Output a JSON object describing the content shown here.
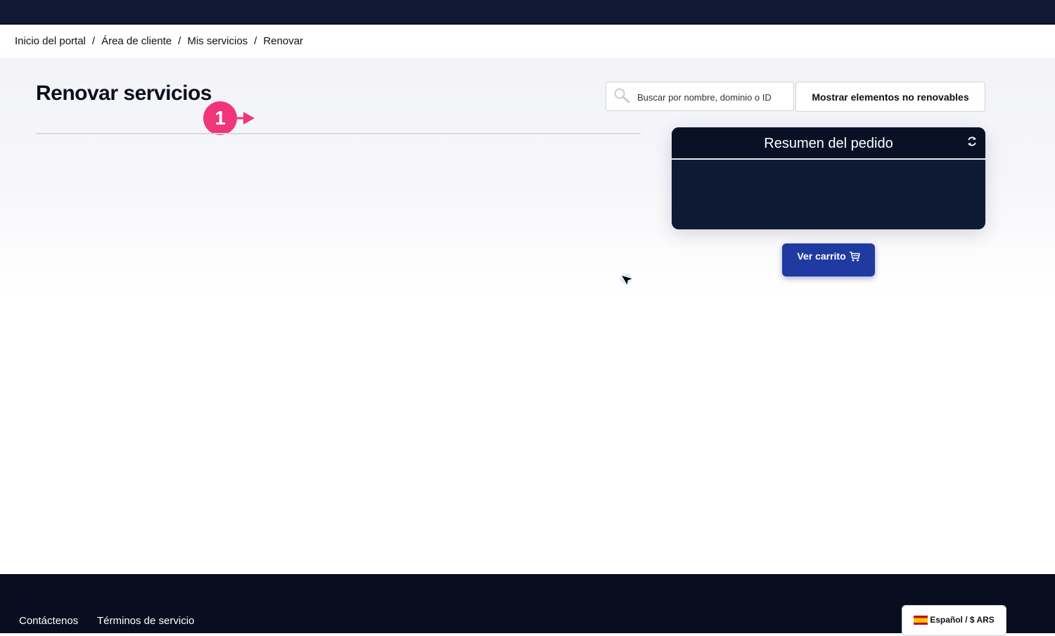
{
  "breadcrumb": {
    "items": [
      "Inicio del portal",
      "Área de cliente",
      "Mis servicios",
      "Renovar"
    ],
    "separator": "/"
  },
  "page": {
    "title": "Renovar servicios",
    "step_marker": "1"
  },
  "search": {
    "placeholder": "Buscar por nombre, dominio o ID",
    "value": ""
  },
  "toolbar": {
    "show_nonrenewable_label": "Mostrar elementos no renovables"
  },
  "order_summary": {
    "title": "Resumen del pedido"
  },
  "cart": {
    "view_cart_label": "Ver carrito"
  },
  "footer": {
    "links": [
      "Contáctenos",
      "Términos de servicio"
    ],
    "language_currency": "Español / $ ARS"
  },
  "colors": {
    "topbar": "#101a35",
    "footer": "#080d20",
    "summary_card": "#0e1934",
    "primary_button": "#1f3aa0",
    "step_marker": "#f0357a"
  },
  "icons": [
    "search-icon",
    "refresh-icon",
    "cart-icon",
    "spain-flag-icon",
    "mouse-cursor-icon",
    "arrow-right-icon"
  ]
}
